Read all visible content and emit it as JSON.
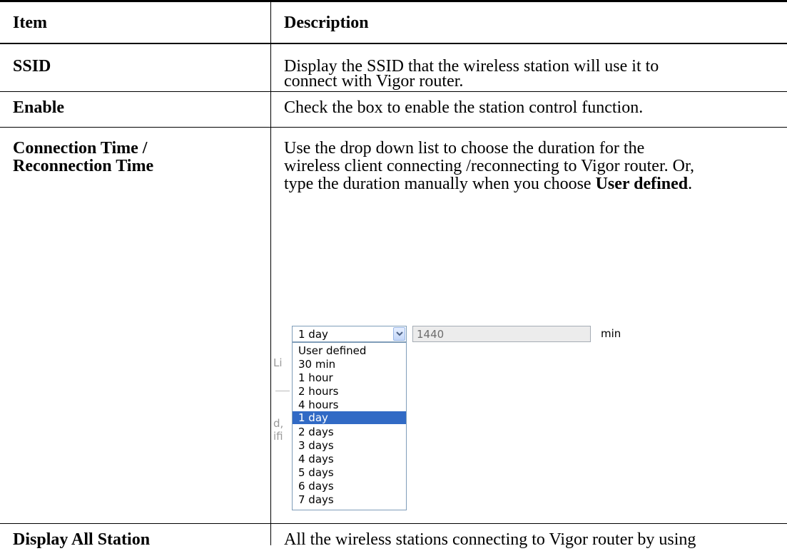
{
  "header": {
    "item": "Item",
    "description": "Description"
  },
  "rows": [
    {
      "item": "SSID",
      "lines": [
        "Display the SSID that the wireless station will use it to",
        "connect with Vigor router."
      ]
    },
    {
      "item": "Enable",
      "lines": [
        "Check the box to enable the station control function."
      ]
    },
    {
      "item_lines": [
        "Connection Time /",
        "Reconnection Time"
      ],
      "lines": [
        "Use the drop down list to choose the duration for the",
        "wireless client connecting /reconnecting to Vigor router. Or,",
        "type the duration manually when you choose "
      ],
      "bold_tail": "User defined",
      "tail_end": "."
    },
    {
      "item": "Display All Station",
      "lines": [
        "All the wireless stations connecting to Vigor router by using"
      ]
    }
  ],
  "dropdown": {
    "selected": "1 day",
    "input_value": "1440",
    "unit": "min",
    "options": [
      "User defined",
      "30 min",
      "1 hour",
      "2 hours",
      "4 hours",
      "1 day",
      "2 days",
      "3 days",
      "4 days",
      "5 days",
      "6 days",
      "7 days"
    ],
    "highlighted_index": 5
  },
  "ghost_fragments": [
    "Li",
    "d,",
    "ifi"
  ],
  "colors": {
    "highlight": "#316ac5",
    "border": "#7f9db9",
    "disabled_bg": "#ececec"
  }
}
